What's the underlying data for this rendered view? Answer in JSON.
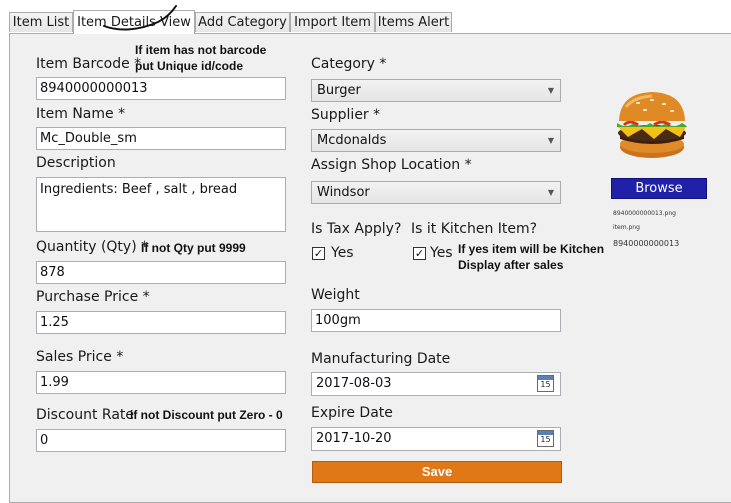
{
  "tabs": [
    {
      "label": "Item List"
    },
    {
      "label": "Item Details View"
    },
    {
      "label": "Add Category"
    },
    {
      "label": "Import Item"
    },
    {
      "label": "Items Alert"
    }
  ],
  "form": {
    "barcode": {
      "label": "Item Barcode *",
      "note_line1": "If item has not barcode",
      "note_line2": "put Unique id/code",
      "value": "8940000000013"
    },
    "name": {
      "label": "Item Name *",
      "value": "Mc_Double_sm"
    },
    "description": {
      "label": "Description",
      "value": "Ingredients: Beef , salt , bread"
    },
    "quantity": {
      "label": "Quantity (Qty) *",
      "note": "If not Qty put  9999",
      "value": "878"
    },
    "purchase_price": {
      "label": "Purchase Price *",
      "value": "1.25"
    },
    "sales_price": {
      "label": "Sales Price *",
      "value": "1.99"
    },
    "discount": {
      "label": "Discount Rate",
      "note": "if not Discount put Zero - 0",
      "value": "0"
    },
    "category": {
      "label": "Category *",
      "value": "Burger"
    },
    "supplier": {
      "label": "Supplier *",
      "value": "Mcdonalds"
    },
    "location": {
      "label": "Assign Shop Location *",
      "value": "Windsor"
    },
    "tax": {
      "label": "Is Tax Apply?",
      "option": "Yes",
      "checked": true
    },
    "kitchen": {
      "label": "Is it Kitchen Item?",
      "option": "Yes",
      "checked": true,
      "note_line1": "If yes item will be Kitchen",
      "note_line2": "Display  after sales"
    },
    "weight": {
      "label": "Weight",
      "value": "100gm"
    },
    "manufacturing_date": {
      "label": "Manufacturing Date",
      "value": "2017-08-03"
    },
    "expire_date": {
      "label": "Expire Date",
      "value": "2017-10-20"
    },
    "calendar_day": "15",
    "save_label": "Save"
  },
  "image": {
    "browse_label": "Browse",
    "file1": "8940000000013.png",
    "file2": "item.png",
    "code": "8940000000013"
  },
  "colors": {
    "save": "#e07817",
    "browse": "#2020a8",
    "panel": "#f0f0f0"
  }
}
